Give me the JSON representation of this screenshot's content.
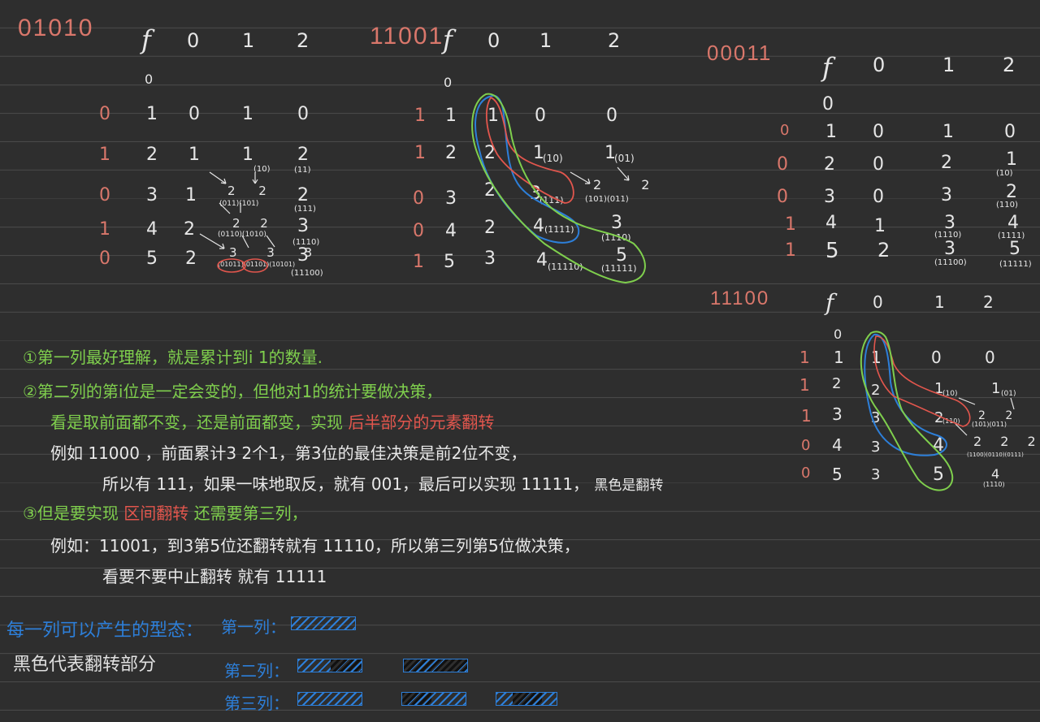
{
  "cols_header": [
    "f",
    "0",
    "1",
    "2"
  ],
  "tables": [
    {
      "key": "t1",
      "title": "01010",
      "zero": "0",
      "rows": [
        {
          "bit": "0",
          "f": "1",
          "c0": "0",
          "c1": "1",
          "c2": "0"
        },
        {
          "bit": "1",
          "f": "2",
          "c0": "1",
          "c1": "1",
          "c1s": "(10)",
          "c2": "2",
          "c2s": "(11)"
        },
        {
          "bit": "0",
          "f": "3",
          "c0": "1",
          "c1": "2 2",
          "c1s": "(011)(101)",
          "c2": "2",
          "c2s": "(111)"
        },
        {
          "bit": "1",
          "f": "4",
          "c0": "2",
          "c1": "2 2",
          "c1s": "(0110)(1010)",
          "c2": "3",
          "c2s": "(1110)"
        },
        {
          "bit": "0",
          "f": "5",
          "c0": "2",
          "c1": "3 3 3",
          "c1s": "(01011)(01101)(10101)",
          "c2": "3",
          "c2s": "(11100)"
        }
      ]
    },
    {
      "key": "t2",
      "title": "11001",
      "zero": "0",
      "rows": [
        {
          "bit": "1",
          "f": "1",
          "c0": "1",
          "c1": "0",
          "c2": "0"
        },
        {
          "bit": "1",
          "f": "2",
          "c0": "2",
          "c1": "1",
          "c1s": "(10)",
          "c2": "1",
          "c2s": "(01)"
        },
        {
          "bit": "0",
          "f": "3",
          "c0": "2",
          "c1": "3",
          "c1s": "(111)",
          "c2": "2 2",
          "c2s": "(101)(011)"
        },
        {
          "bit": "0",
          "f": "4",
          "c0": "2",
          "c1": "4",
          "c1s": "(1111)",
          "c2": "3",
          "c2s": "(1110)"
        },
        {
          "bit": "1",
          "f": "5",
          "c0": "3",
          "c1": "4",
          "c1s": "(11110)",
          "c2": "5",
          "c2s": "(11111)"
        }
      ]
    },
    {
      "key": "t3",
      "title": "00011",
      "zero": "0",
      "rows": [
        {
          "bit": "0",
          "f": "1",
          "c0": "0",
          "c1": "1",
          "c2": "0"
        },
        {
          "bit": "0",
          "f": "2",
          "c0": "0",
          "c1": "2",
          "c2": "1",
          "c2s": "(10)"
        },
        {
          "bit": "0",
          "f": "3",
          "c0": "0",
          "c1": "3",
          "c2": "2",
          "c2s": "(110)"
        },
        {
          "bit": "1",
          "f": "4",
          "c0": "1",
          "c1": "3",
          "c1s": "(1110)",
          "c2": "4",
          "c2s": "(1111)"
        },
        {
          "bit": "1",
          "f": "5",
          "c0": "2",
          "c1": "3",
          "c1s": "(11100)",
          "c2": "5",
          "c2s": "(11111)"
        }
      ]
    },
    {
      "key": "t4",
      "title": "11100",
      "zero": "0",
      "rows": [
        {
          "bit": "1",
          "f": "1",
          "c0": "1",
          "c1": "0",
          "c2": "0"
        },
        {
          "bit": "1",
          "f": "2",
          "c0": "2",
          "c1": "1",
          "c1s": "(10)",
          "c2": "1",
          "c2s": "(01)"
        },
        {
          "bit": "1",
          "f": "3",
          "c0": "3",
          "c1": "2",
          "c1s": "(110)",
          "c2": "2 2",
          "c2s": "(101)(011)"
        },
        {
          "bit": "0",
          "f": "4",
          "c0": "3",
          "c1": "4",
          "c2": "2 2 2",
          "c2s": "(1100)(0110)(0111)"
        },
        {
          "bit": "0",
          "f": "5",
          "c0": "3",
          "c1": "5",
          "c2": "4",
          "c2s": "(1110)"
        }
      ]
    }
  ],
  "notes": {
    "n1": "①第一列最好理解，就是累计到i 1的数量.",
    "n2": "②第二列的第i位是一定会变的，但他对1的统计要做决策，",
    "n3a": "看是取前面都不变，还是前面都变，实现",
    "n3b": "后半部分的元素翻转",
    "n4": "例如 11000 ，前面累计3 2个1，第3位的最佳决策是前2位不变，",
    "n5a": "所以有 111，如果一味地取反，就有 001，最后可以实现 11111，",
    "n5b": "黑色是翻转",
    "n6a": "③但是要实现",
    "n6b": "区间翻转",
    "n6c": "还需要第三列，",
    "n7": "例如：11001，到3第5位还翻转就有 11110，所以第三列第5位做决策，",
    "n8": "看要不要中止翻转 就有 11111"
  },
  "legend": {
    "title": "每一列可以产生的型态：",
    "black_note": "黑色代表翻转部分",
    "col1": "第一列：",
    "col2": "第二列：",
    "col3": "第三列："
  },
  "colors": {
    "background": "#2e2e2e",
    "title_red": "#d9776b",
    "note_green": "#7fcf4d",
    "highlight_red": "#e2564d",
    "legend_blue": "#2d7fd9",
    "ink": "#e8e8e8"
  }
}
